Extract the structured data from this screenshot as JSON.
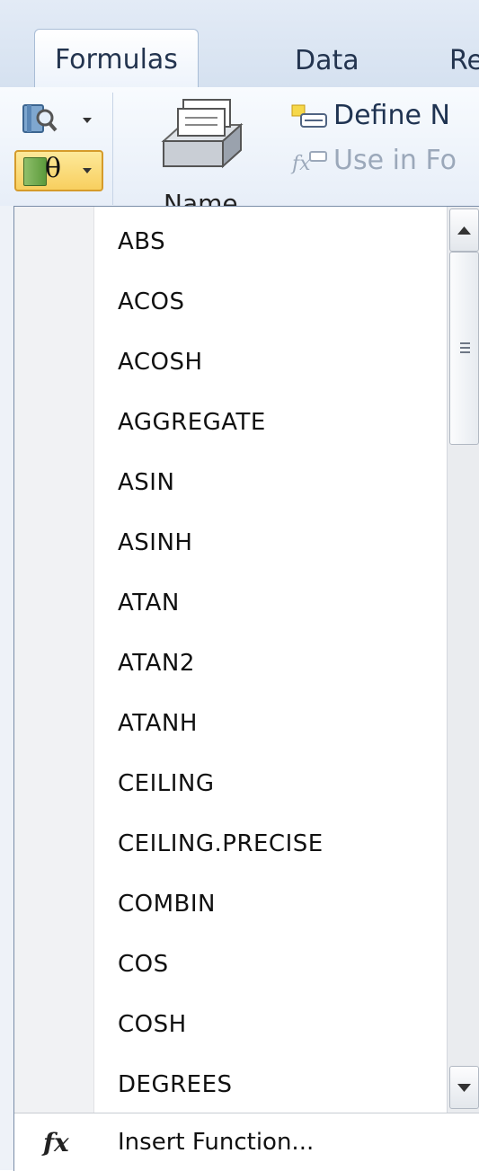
{
  "ribbon": {
    "tabs": [
      {
        "label": "Formulas",
        "active": true
      },
      {
        "label": "Data"
      },
      {
        "label": "Re"
      }
    ],
    "name_manager_label": "Name",
    "define_name_label": "Define N",
    "use_in_formula_label": "Use in Fo"
  },
  "menu": {
    "items": [
      "ABS",
      "ACOS",
      "ACOSH",
      "AGGREGATE",
      "ASIN",
      "ASINH",
      "ATAN",
      "ATAN2",
      "ATANH",
      "CEILING",
      "CEILING.PRECISE",
      "COMBIN",
      "COS",
      "COSH",
      "DEGREES"
    ],
    "insert_function_label": "Insert Function...",
    "insert_function_icon": "fx-icon"
  },
  "colors": {
    "selected_button_bg": "#f8cf5f",
    "menu_gutter": "#f1f2f4"
  }
}
